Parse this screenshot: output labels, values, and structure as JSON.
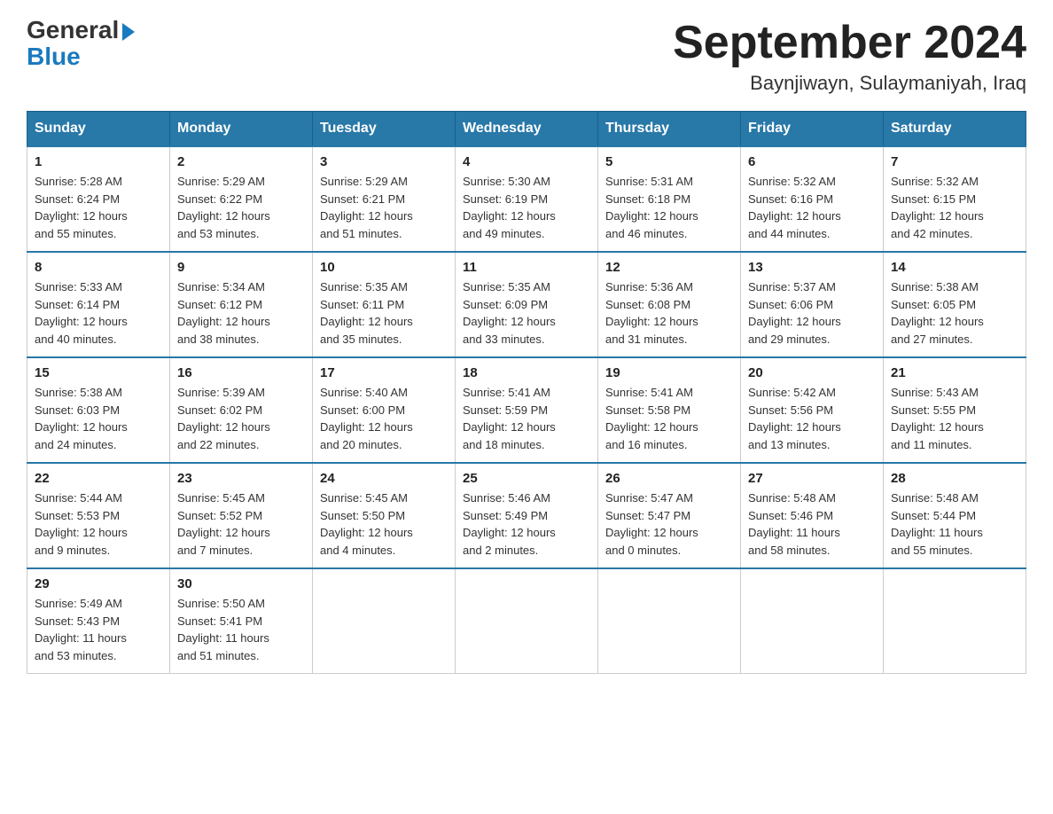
{
  "header": {
    "logo_general": "General",
    "logo_blue": "Blue",
    "month_title": "September 2024",
    "location": "Baynjiwayn, Sulaymaniyah, Iraq"
  },
  "days_of_week": [
    "Sunday",
    "Monday",
    "Tuesday",
    "Wednesday",
    "Thursday",
    "Friday",
    "Saturday"
  ],
  "weeks": [
    [
      {
        "num": "1",
        "sunrise": "5:28 AM",
        "sunset": "6:24 PM",
        "daylight": "12 hours and 55 minutes."
      },
      {
        "num": "2",
        "sunrise": "5:29 AM",
        "sunset": "6:22 PM",
        "daylight": "12 hours and 53 minutes."
      },
      {
        "num": "3",
        "sunrise": "5:29 AM",
        "sunset": "6:21 PM",
        "daylight": "12 hours and 51 minutes."
      },
      {
        "num": "4",
        "sunrise": "5:30 AM",
        "sunset": "6:19 PM",
        "daylight": "12 hours and 49 minutes."
      },
      {
        "num": "5",
        "sunrise": "5:31 AM",
        "sunset": "6:18 PM",
        "daylight": "12 hours and 46 minutes."
      },
      {
        "num": "6",
        "sunrise": "5:32 AM",
        "sunset": "6:16 PM",
        "daylight": "12 hours and 44 minutes."
      },
      {
        "num": "7",
        "sunrise": "5:32 AM",
        "sunset": "6:15 PM",
        "daylight": "12 hours and 42 minutes."
      }
    ],
    [
      {
        "num": "8",
        "sunrise": "5:33 AM",
        "sunset": "6:14 PM",
        "daylight": "12 hours and 40 minutes."
      },
      {
        "num": "9",
        "sunrise": "5:34 AM",
        "sunset": "6:12 PM",
        "daylight": "12 hours and 38 minutes."
      },
      {
        "num": "10",
        "sunrise": "5:35 AM",
        "sunset": "6:11 PM",
        "daylight": "12 hours and 35 minutes."
      },
      {
        "num": "11",
        "sunrise": "5:35 AM",
        "sunset": "6:09 PM",
        "daylight": "12 hours and 33 minutes."
      },
      {
        "num": "12",
        "sunrise": "5:36 AM",
        "sunset": "6:08 PM",
        "daylight": "12 hours and 31 minutes."
      },
      {
        "num": "13",
        "sunrise": "5:37 AM",
        "sunset": "6:06 PM",
        "daylight": "12 hours and 29 minutes."
      },
      {
        "num": "14",
        "sunrise": "5:38 AM",
        "sunset": "6:05 PM",
        "daylight": "12 hours and 27 minutes."
      }
    ],
    [
      {
        "num": "15",
        "sunrise": "5:38 AM",
        "sunset": "6:03 PM",
        "daylight": "12 hours and 24 minutes."
      },
      {
        "num": "16",
        "sunrise": "5:39 AM",
        "sunset": "6:02 PM",
        "daylight": "12 hours and 22 minutes."
      },
      {
        "num": "17",
        "sunrise": "5:40 AM",
        "sunset": "6:00 PM",
        "daylight": "12 hours and 20 minutes."
      },
      {
        "num": "18",
        "sunrise": "5:41 AM",
        "sunset": "5:59 PM",
        "daylight": "12 hours and 18 minutes."
      },
      {
        "num": "19",
        "sunrise": "5:41 AM",
        "sunset": "5:58 PM",
        "daylight": "12 hours and 16 minutes."
      },
      {
        "num": "20",
        "sunrise": "5:42 AM",
        "sunset": "5:56 PM",
        "daylight": "12 hours and 13 minutes."
      },
      {
        "num": "21",
        "sunrise": "5:43 AM",
        "sunset": "5:55 PM",
        "daylight": "12 hours and 11 minutes."
      }
    ],
    [
      {
        "num": "22",
        "sunrise": "5:44 AM",
        "sunset": "5:53 PM",
        "daylight": "12 hours and 9 minutes."
      },
      {
        "num": "23",
        "sunrise": "5:45 AM",
        "sunset": "5:52 PM",
        "daylight": "12 hours and 7 minutes."
      },
      {
        "num": "24",
        "sunrise": "5:45 AM",
        "sunset": "5:50 PM",
        "daylight": "12 hours and 4 minutes."
      },
      {
        "num": "25",
        "sunrise": "5:46 AM",
        "sunset": "5:49 PM",
        "daylight": "12 hours and 2 minutes."
      },
      {
        "num": "26",
        "sunrise": "5:47 AM",
        "sunset": "5:47 PM",
        "daylight": "12 hours and 0 minutes."
      },
      {
        "num": "27",
        "sunrise": "5:48 AM",
        "sunset": "5:46 PM",
        "daylight": "11 hours and 58 minutes."
      },
      {
        "num": "28",
        "sunrise": "5:48 AM",
        "sunset": "5:44 PM",
        "daylight": "11 hours and 55 minutes."
      }
    ],
    [
      {
        "num": "29",
        "sunrise": "5:49 AM",
        "sunset": "5:43 PM",
        "daylight": "11 hours and 53 minutes."
      },
      {
        "num": "30",
        "sunrise": "5:50 AM",
        "sunset": "5:41 PM",
        "daylight": "11 hours and 51 minutes."
      },
      null,
      null,
      null,
      null,
      null
    ]
  ],
  "labels": {
    "sunrise": "Sunrise:",
    "sunset": "Sunset:",
    "daylight": "Daylight:"
  }
}
